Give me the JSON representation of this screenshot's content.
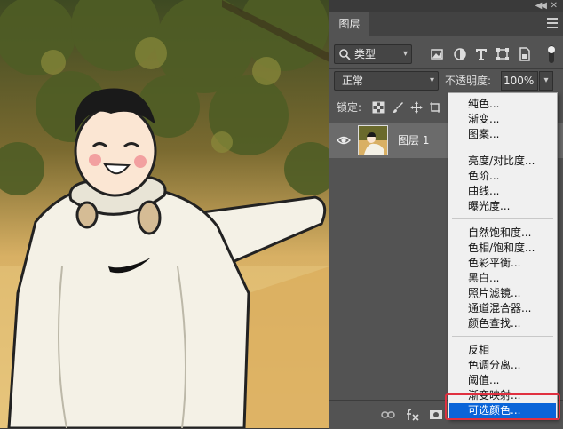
{
  "panel": {
    "tab_label": "图层",
    "filter": {
      "kind_label": "类型"
    },
    "blend": {
      "mode": "正常",
      "opacity_label": "不透明度:",
      "opacity_value": "100%"
    },
    "lock_label": "锁定:",
    "layers": [
      {
        "name": "图层 1",
        "visible": true
      }
    ],
    "bottom_icons": [
      "link-icon",
      "fx-icon",
      "mask-icon"
    ]
  },
  "adjustment_menu": {
    "groups": [
      [
        "纯色...",
        "渐变...",
        "图案..."
      ],
      [
        "亮度/对比度...",
        "色阶...",
        "曲线...",
        "曝光度..."
      ],
      [
        "自然饱和度...",
        "色相/饱和度...",
        "色彩平衡...",
        "黑白...",
        "照片滤镜...",
        "通道混合器...",
        "颜色查找..."
      ],
      [
        "反相",
        "色调分离...",
        "阈值...",
        "渐变映射...",
        "可选颜色..."
      ]
    ],
    "selected": "可选颜色...",
    "highlight_color": "#e03040",
    "selection_color": "#0a64d8"
  }
}
